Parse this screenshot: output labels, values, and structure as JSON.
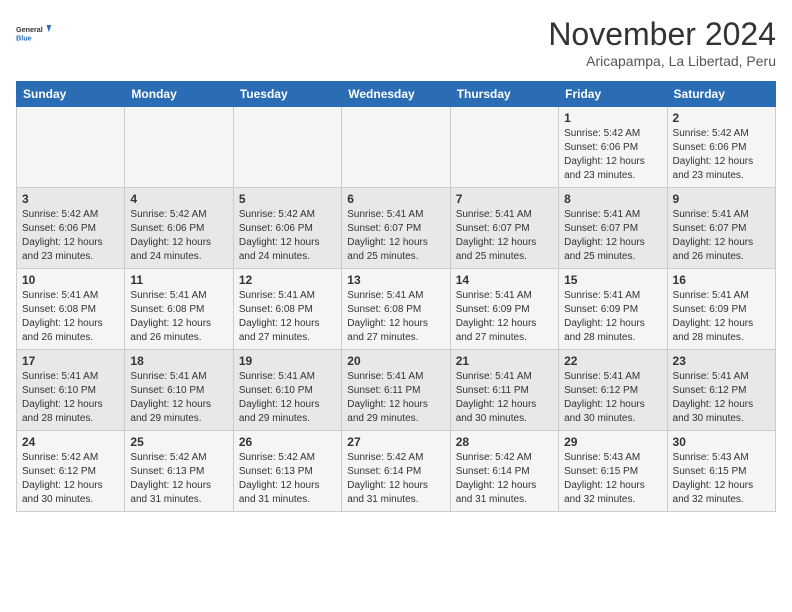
{
  "header": {
    "logo_line1": "General",
    "logo_line2": "Blue",
    "month": "November 2024",
    "location": "Aricapampa, La Libertad, Peru"
  },
  "weekdays": [
    "Sunday",
    "Monday",
    "Tuesday",
    "Wednesday",
    "Thursday",
    "Friday",
    "Saturday"
  ],
  "weeks": [
    [
      {
        "day": "",
        "info": ""
      },
      {
        "day": "",
        "info": ""
      },
      {
        "day": "",
        "info": ""
      },
      {
        "day": "",
        "info": ""
      },
      {
        "day": "",
        "info": ""
      },
      {
        "day": "1",
        "info": "Sunrise: 5:42 AM\nSunset: 6:06 PM\nDaylight: 12 hours\nand 23 minutes."
      },
      {
        "day": "2",
        "info": "Sunrise: 5:42 AM\nSunset: 6:06 PM\nDaylight: 12 hours\nand 23 minutes."
      }
    ],
    [
      {
        "day": "3",
        "info": "Sunrise: 5:42 AM\nSunset: 6:06 PM\nDaylight: 12 hours\nand 23 minutes."
      },
      {
        "day": "4",
        "info": "Sunrise: 5:42 AM\nSunset: 6:06 PM\nDaylight: 12 hours\nand 24 minutes."
      },
      {
        "day": "5",
        "info": "Sunrise: 5:42 AM\nSunset: 6:06 PM\nDaylight: 12 hours\nand 24 minutes."
      },
      {
        "day": "6",
        "info": "Sunrise: 5:41 AM\nSunset: 6:07 PM\nDaylight: 12 hours\nand 25 minutes."
      },
      {
        "day": "7",
        "info": "Sunrise: 5:41 AM\nSunset: 6:07 PM\nDaylight: 12 hours\nand 25 minutes."
      },
      {
        "day": "8",
        "info": "Sunrise: 5:41 AM\nSunset: 6:07 PM\nDaylight: 12 hours\nand 25 minutes."
      },
      {
        "day": "9",
        "info": "Sunrise: 5:41 AM\nSunset: 6:07 PM\nDaylight: 12 hours\nand 26 minutes."
      }
    ],
    [
      {
        "day": "10",
        "info": "Sunrise: 5:41 AM\nSunset: 6:08 PM\nDaylight: 12 hours\nand 26 minutes."
      },
      {
        "day": "11",
        "info": "Sunrise: 5:41 AM\nSunset: 6:08 PM\nDaylight: 12 hours\nand 26 minutes."
      },
      {
        "day": "12",
        "info": "Sunrise: 5:41 AM\nSunset: 6:08 PM\nDaylight: 12 hours\nand 27 minutes."
      },
      {
        "day": "13",
        "info": "Sunrise: 5:41 AM\nSunset: 6:08 PM\nDaylight: 12 hours\nand 27 minutes."
      },
      {
        "day": "14",
        "info": "Sunrise: 5:41 AM\nSunset: 6:09 PM\nDaylight: 12 hours\nand 27 minutes."
      },
      {
        "day": "15",
        "info": "Sunrise: 5:41 AM\nSunset: 6:09 PM\nDaylight: 12 hours\nand 28 minutes."
      },
      {
        "day": "16",
        "info": "Sunrise: 5:41 AM\nSunset: 6:09 PM\nDaylight: 12 hours\nand 28 minutes."
      }
    ],
    [
      {
        "day": "17",
        "info": "Sunrise: 5:41 AM\nSunset: 6:10 PM\nDaylight: 12 hours\nand 28 minutes."
      },
      {
        "day": "18",
        "info": "Sunrise: 5:41 AM\nSunset: 6:10 PM\nDaylight: 12 hours\nand 29 minutes."
      },
      {
        "day": "19",
        "info": "Sunrise: 5:41 AM\nSunset: 6:10 PM\nDaylight: 12 hours\nand 29 minutes."
      },
      {
        "day": "20",
        "info": "Sunrise: 5:41 AM\nSunset: 6:11 PM\nDaylight: 12 hours\nand 29 minutes."
      },
      {
        "day": "21",
        "info": "Sunrise: 5:41 AM\nSunset: 6:11 PM\nDaylight: 12 hours\nand 30 minutes."
      },
      {
        "day": "22",
        "info": "Sunrise: 5:41 AM\nSunset: 6:12 PM\nDaylight: 12 hours\nand 30 minutes."
      },
      {
        "day": "23",
        "info": "Sunrise: 5:41 AM\nSunset: 6:12 PM\nDaylight: 12 hours\nand 30 minutes."
      }
    ],
    [
      {
        "day": "24",
        "info": "Sunrise: 5:42 AM\nSunset: 6:12 PM\nDaylight: 12 hours\nand 30 minutes."
      },
      {
        "day": "25",
        "info": "Sunrise: 5:42 AM\nSunset: 6:13 PM\nDaylight: 12 hours\nand 31 minutes."
      },
      {
        "day": "26",
        "info": "Sunrise: 5:42 AM\nSunset: 6:13 PM\nDaylight: 12 hours\nand 31 minutes."
      },
      {
        "day": "27",
        "info": "Sunrise: 5:42 AM\nSunset: 6:14 PM\nDaylight: 12 hours\nand 31 minutes."
      },
      {
        "day": "28",
        "info": "Sunrise: 5:42 AM\nSunset: 6:14 PM\nDaylight: 12 hours\nand 31 minutes."
      },
      {
        "day": "29",
        "info": "Sunrise: 5:43 AM\nSunset: 6:15 PM\nDaylight: 12 hours\nand 32 minutes."
      },
      {
        "day": "30",
        "info": "Sunrise: 5:43 AM\nSunset: 6:15 PM\nDaylight: 12 hours\nand 32 minutes."
      }
    ]
  ]
}
